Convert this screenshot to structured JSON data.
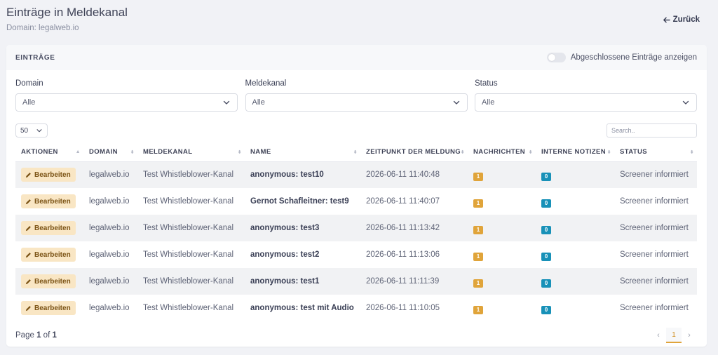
{
  "header": {
    "title": "Einträge in Meldekanal",
    "subtitle": "Domain: legalweb.io",
    "back_label": "Zurück"
  },
  "card": {
    "title": "EINTRÄGE",
    "toggle_label": "Abgeschlossene Einträge anzeigen"
  },
  "filters": {
    "domain": {
      "label": "Domain",
      "value": "Alle"
    },
    "meldekanal": {
      "label": "Meldekanal",
      "value": "Alle"
    },
    "status": {
      "label": "Status",
      "value": "Alle"
    }
  },
  "table_tools": {
    "page_size": "50",
    "search_placeholder": "Search.."
  },
  "table": {
    "columns": [
      "AKTIONEN",
      "DOMAIN",
      "MELDEKANAL",
      "NAME",
      "ZEITPUNKT DER MELDUNG",
      "NACHRICHTEN",
      "INTERNE NOTIZEN",
      "STATUS"
    ],
    "edit_label": "Bearbeiten",
    "rows": [
      {
        "domain": "legalweb.io",
        "meldekanal": "Test Whistleblower-Kanal",
        "name": "anonymous: test10",
        "zeitpunkt": "2026-06-11 11:40:48",
        "nachrichten": "1",
        "notizen": "0",
        "status": "Screener informiert"
      },
      {
        "domain": "legalweb.io",
        "meldekanal": "Test Whistleblower-Kanal",
        "name": "Gernot Schafleitner: test9",
        "zeitpunkt": "2026-06-11 11:40:07",
        "nachrichten": "1",
        "notizen": "0",
        "status": "Screener informiert"
      },
      {
        "domain": "legalweb.io",
        "meldekanal": "Test Whistleblower-Kanal",
        "name": "anonymous: test3",
        "zeitpunkt": "2026-06-11 11:13:42",
        "nachrichten": "1",
        "notizen": "0",
        "status": "Screener informiert"
      },
      {
        "domain": "legalweb.io",
        "meldekanal": "Test Whistleblower-Kanal",
        "name": "anonymous: test2",
        "zeitpunkt": "2026-06-11 11:13:06",
        "nachrichten": "1",
        "notizen": "0",
        "status": "Screener informiert"
      },
      {
        "domain": "legalweb.io",
        "meldekanal": "Test Whistleblower-Kanal",
        "name": "anonymous: test1",
        "zeitpunkt": "2026-06-11 11:11:39",
        "nachrichten": "1",
        "notizen": "0",
        "status": "Screener informiert"
      },
      {
        "domain": "legalweb.io",
        "meldekanal": "Test Whistleblower-Kanal",
        "name": "anonymous: test mit Audio",
        "zeitpunkt": "2026-06-11 11:10:05",
        "nachrichten": "1",
        "notizen": "0",
        "status": "Screener informiert"
      }
    ]
  },
  "footer": {
    "page_prefix": "Page",
    "current_page": "1",
    "page_of": "of",
    "total_pages": "1",
    "pager_current": "1"
  },
  "colors": {
    "accent_orange": "#e0a43a",
    "notes_blue": "#1891b8",
    "edit_button_bg": "#f9e6c4"
  },
  "icons": {
    "back": "arrow-left-icon",
    "edit": "pencil-icon",
    "select": "chevron-down-icon",
    "sort": "sort-icon",
    "prev": "chevron-left-icon",
    "next": "chevron-right-icon"
  }
}
